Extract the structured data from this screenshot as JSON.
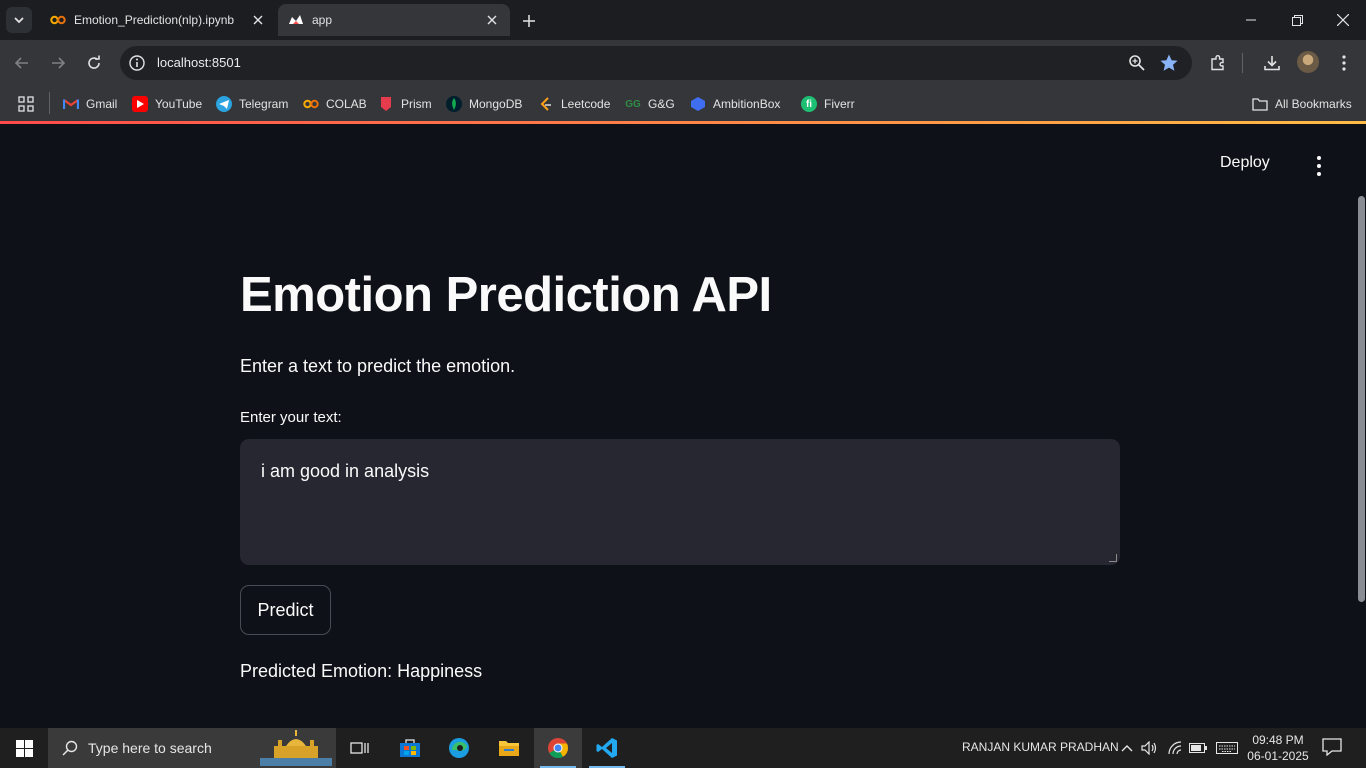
{
  "browser": {
    "tabs": [
      {
        "title": "Emotion_Prediction(nlp).ipynb",
        "icon": "colab-icon",
        "active": false
      },
      {
        "title": "app",
        "icon": "streamlit-icon",
        "active": true
      }
    ],
    "url": "localhost:8501",
    "bookmarks": [
      {
        "label": "Gmail",
        "icon": "gmail-icon",
        "color": "#ea4335"
      },
      {
        "label": "YouTube",
        "icon": "youtube-icon",
        "color": "#ff0000"
      },
      {
        "label": "Telegram",
        "icon": "telegram-icon",
        "color": "#2aa3e0"
      },
      {
        "label": "COLAB",
        "icon": "colab-icon",
        "color": "#f9ab00"
      },
      {
        "label": "Prism",
        "icon": "prism-icon",
        "color": "#e53b4c"
      },
      {
        "label": "MongoDB",
        "icon": "mongodb-icon",
        "color": "#13aa52"
      },
      {
        "label": "Leetcode",
        "icon": "leetcode-icon",
        "color": "#ffa116"
      },
      {
        "label": "G&G",
        "icon": "geeksforgeeks-icon",
        "color": "#2f8d46"
      },
      {
        "label": "AmbitionBox",
        "icon": "ambitionbox-icon",
        "color": "#3f6ff0"
      },
      {
        "label": "Fiverr",
        "icon": "fiverr-icon",
        "color": "#1dbf73"
      }
    ],
    "all_bookmarks": "All Bookmarks"
  },
  "app": {
    "deploy_label": "Deploy",
    "title": "Emotion Prediction API",
    "subtitle": "Enter a text to predict the emotion.",
    "input_label": "Enter your text:",
    "input_value": "i am good in analysis",
    "predict_label": "Predict",
    "result": "Predicted Emotion: Happiness",
    "accent_colors": [
      "#ff4b4b",
      "#ffbd45"
    ]
  },
  "taskbar": {
    "search_placeholder": "Type here to search",
    "user": "RANJAN KUMAR PRADHAN",
    "time": "09:48 PM",
    "date": "06-01-2025"
  }
}
